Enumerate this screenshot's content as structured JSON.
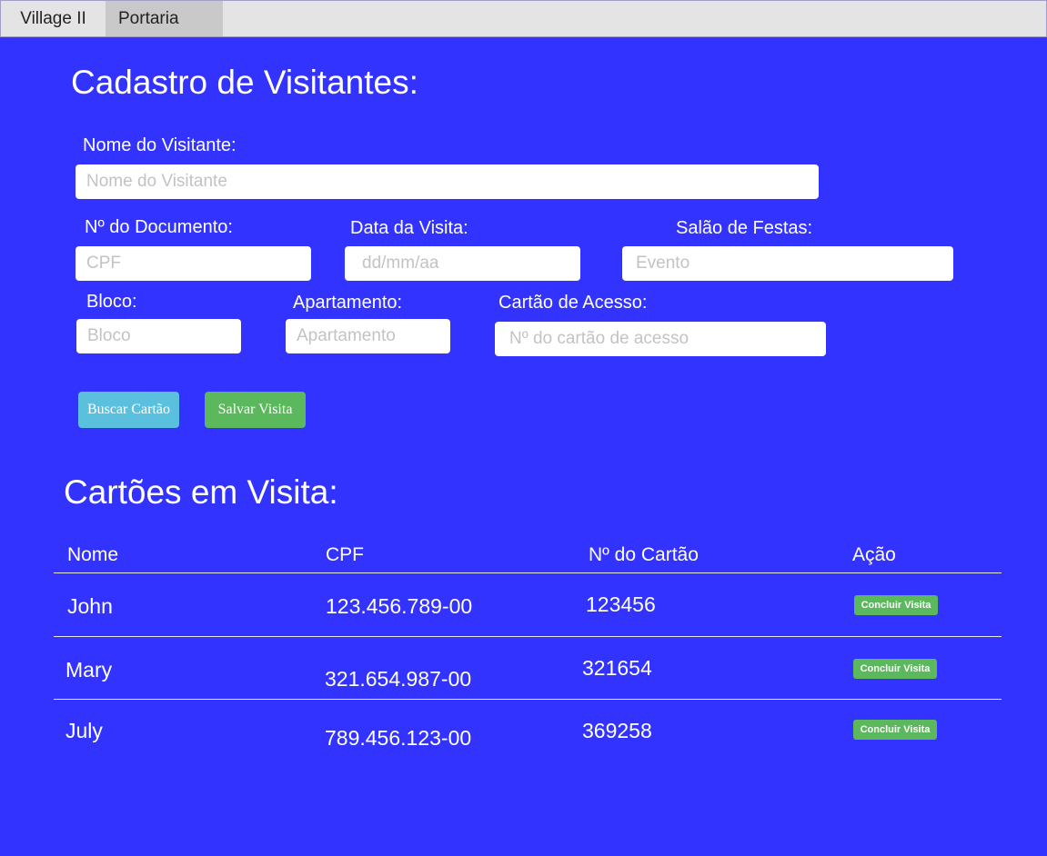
{
  "nav": {
    "brand": "Village II",
    "tabs": [
      "Portaria"
    ]
  },
  "form": {
    "title": "Cadastro de Visitantes:",
    "fields": {
      "nome": {
        "label": "Nome do Visitante:",
        "placeholder": "Nome do Visitante",
        "value": ""
      },
      "documento": {
        "label": "Nº do Documento:",
        "placeholder": "CPF",
        "value": ""
      },
      "data": {
        "label": "Data da Visita:",
        "placeholder": "dd/mm/aa",
        "value": ""
      },
      "salao": {
        "label": "Salão de Festas:",
        "placeholder": "Evento",
        "value": ""
      },
      "bloco": {
        "label": "Bloco:",
        "placeholder": "Bloco",
        "value": ""
      },
      "apartamento": {
        "label": "Apartamento:",
        "placeholder": "Apartamento",
        "value": ""
      },
      "cartao": {
        "label": "Cartão de Acesso:",
        "placeholder": "Nº do cartão de acesso",
        "value": ""
      }
    },
    "buttons": {
      "buscar": "Buscar Cartão",
      "salvar": "Salvar Visita"
    }
  },
  "visits": {
    "title": "Cartões em Visita:",
    "columns": [
      "Nome",
      "CPF",
      "Nº do Cartão",
      "Ação"
    ],
    "rows": [
      {
        "nome": "John",
        "cpf": "123.456.789-00",
        "cartao": "123456",
        "acao": "Concluir Visita"
      },
      {
        "nome": "Mary",
        "cpf": "321.654.987-00",
        "cartao": "321654",
        "acao": "Concluir Visita"
      },
      {
        "nome": "July",
        "cpf": "789.456.123-00",
        "cartao": "369258",
        "acao": "Concluir Visita"
      }
    ]
  },
  "colors": {
    "background": "#3333ff",
    "nav": "#e4e4e4",
    "nav_active": "#c9c9c9",
    "info_button": "#5bc0de",
    "success_button": "#5cb85c"
  }
}
